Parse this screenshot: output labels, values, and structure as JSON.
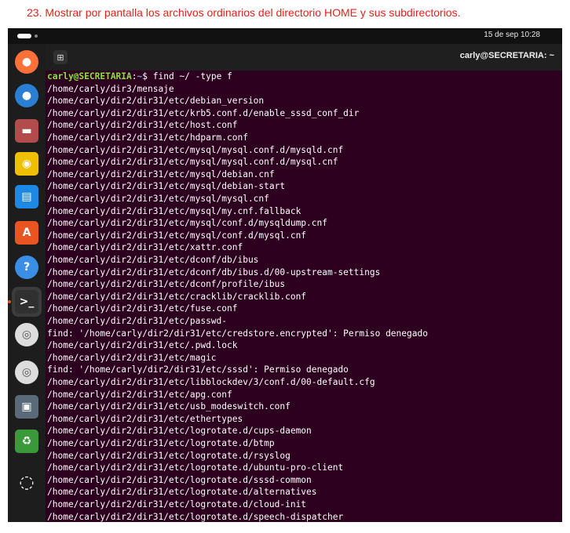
{
  "caption": "23. Mostrar por pantalla los archivos ordinarios del directorio HOME y sus subdirectorios.",
  "topbar": {
    "clock": "15 de sep  10:28"
  },
  "window": {
    "title": "carly@SECRETARIA: ~",
    "new_tab_icon": "new-tab-icon"
  },
  "dock": {
    "apps": [
      {
        "name": "firefox",
        "icon": "firefox-icon",
        "color": "#ff7139"
      },
      {
        "name": "thunderbird",
        "icon": "thunderbird-icon",
        "color": "#2a7fd4"
      },
      {
        "name": "files",
        "icon": "folder-icon",
        "color": "#b24b4b"
      },
      {
        "name": "rhythmbox",
        "icon": "speaker-icon",
        "color": "#f0c000"
      },
      {
        "name": "writer",
        "icon": "document-icon",
        "color": "#1e88e5"
      },
      {
        "name": "app-center",
        "icon": "app-center-icon",
        "color": "#e95420"
      },
      {
        "name": "help",
        "icon": "help-icon",
        "color": "#3a8ee6"
      },
      {
        "name": "terminal",
        "icon": "terminal-icon",
        "color": "#303030"
      },
      {
        "name": "disc-1",
        "icon": "disc-icon",
        "color": "#dddddd"
      },
      {
        "name": "disc-2",
        "icon": "disc-icon",
        "color": "#dddddd"
      },
      {
        "name": "save",
        "icon": "floppy-icon",
        "color": "#5a6a78"
      },
      {
        "name": "trash",
        "icon": "trash-icon",
        "color": "#3a9a3a"
      },
      {
        "name": "apps-grid",
        "icon": "ubuntu-logo-icon",
        "color": "#ffffff"
      }
    ]
  },
  "terminal": {
    "prompt_user": "carly@SECRETARIA",
    "prompt_sep": ":",
    "prompt_path": "~",
    "prompt_symbol": "$ ",
    "command": "find ~/ -type f",
    "output": [
      "/home/carly/dir3/mensaje",
      "/home/carly/dir2/dir31/etc/debian_version",
      "/home/carly/dir2/dir31/etc/krb5.conf.d/enable_sssd_conf_dir",
      "/home/carly/dir2/dir31/etc/host.conf",
      "/home/carly/dir2/dir31/etc/hdparm.conf",
      "/home/carly/dir2/dir31/etc/mysql/mysql.conf.d/mysqld.cnf",
      "/home/carly/dir2/dir31/etc/mysql/mysql.conf.d/mysql.cnf",
      "/home/carly/dir2/dir31/etc/mysql/debian.cnf",
      "/home/carly/dir2/dir31/etc/mysql/debian-start",
      "/home/carly/dir2/dir31/etc/mysql/mysql.cnf",
      "/home/carly/dir2/dir31/etc/mysql/my.cnf.fallback",
      "/home/carly/dir2/dir31/etc/mysql/conf.d/mysqldump.cnf",
      "/home/carly/dir2/dir31/etc/mysql/conf.d/mysql.cnf",
      "/home/carly/dir2/dir31/etc/xattr.conf",
      "/home/carly/dir2/dir31/etc/dconf/db/ibus",
      "/home/carly/dir2/dir31/etc/dconf/db/ibus.d/00-upstream-settings",
      "/home/carly/dir2/dir31/etc/dconf/profile/ibus",
      "/home/carly/dir2/dir31/etc/cracklib/cracklib.conf",
      "/home/carly/dir2/dir31/etc/fuse.conf",
      "/home/carly/dir2/dir31/etc/passwd-",
      "find: '/home/carly/dir2/dir31/etc/credstore.encrypted': Permiso denegado",
      "/home/carly/dir2/dir31/etc/.pwd.lock",
      "/home/carly/dir2/dir31/etc/magic",
      "find: '/home/carly/dir2/dir31/etc/sssd': Permiso denegado",
      "/home/carly/dir2/dir31/etc/libblockdev/3/conf.d/00-default.cfg",
      "/home/carly/dir2/dir31/etc/apg.conf",
      "/home/carly/dir2/dir31/etc/usb_modeswitch.conf",
      "/home/carly/dir2/dir31/etc/ethertypes",
      "/home/carly/dir2/dir31/etc/logrotate.d/cups-daemon",
      "/home/carly/dir2/dir31/etc/logrotate.d/btmp",
      "/home/carly/dir2/dir31/etc/logrotate.d/rsyslog",
      "/home/carly/dir2/dir31/etc/logrotate.d/ubuntu-pro-client",
      "/home/carly/dir2/dir31/etc/logrotate.d/sssd-common",
      "/home/carly/dir2/dir31/etc/logrotate.d/alternatives",
      "/home/carly/dir2/dir31/etc/logrotate.d/cloud-init",
      "/home/carly/dir2/dir31/etc/logrotate.d/speech-dispatcher"
    ]
  }
}
